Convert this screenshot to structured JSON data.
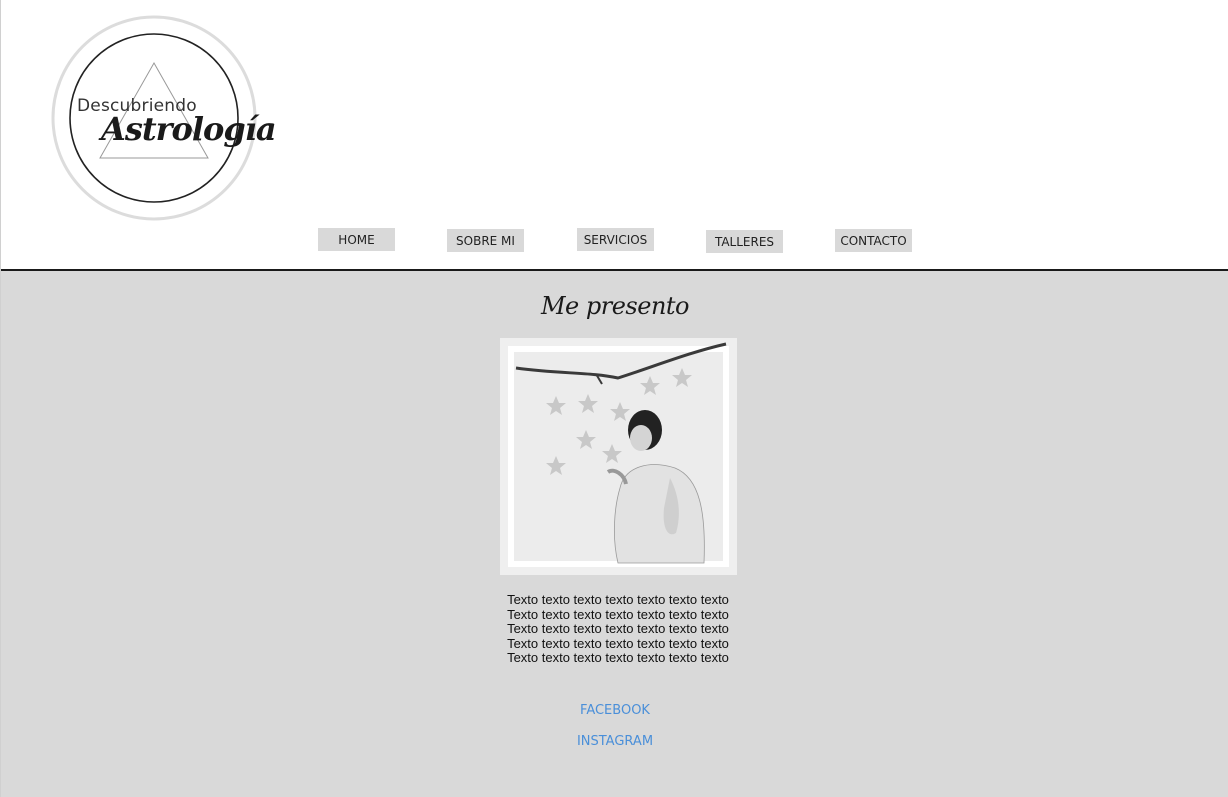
{
  "logo": {
    "line1": "Descubriendo",
    "line2": "Astrología"
  },
  "nav": {
    "items": [
      {
        "label": "HOME"
      },
      {
        "label": "SOBRE MI"
      },
      {
        "label": "SERVICIOS"
      },
      {
        "label": "TALLERES"
      },
      {
        "label": "CONTACTO"
      }
    ]
  },
  "main": {
    "title": "Me presento",
    "text_lines": [
      "Texto texto texto texto texto texto texto",
      "Texto texto texto texto texto texto texto",
      "Texto texto texto texto texto texto texto",
      "Texto texto texto texto texto texto texto",
      "Texto texto texto texto texto texto texto"
    ]
  },
  "social": {
    "facebook": "FACEBOOK",
    "instagram": "INSTAGRAM"
  },
  "colors": {
    "background_main": "#d9d9d9",
    "nav_button": "#d9d9d9",
    "link": "#4a8fd9",
    "divider": "#1a1a1a"
  }
}
